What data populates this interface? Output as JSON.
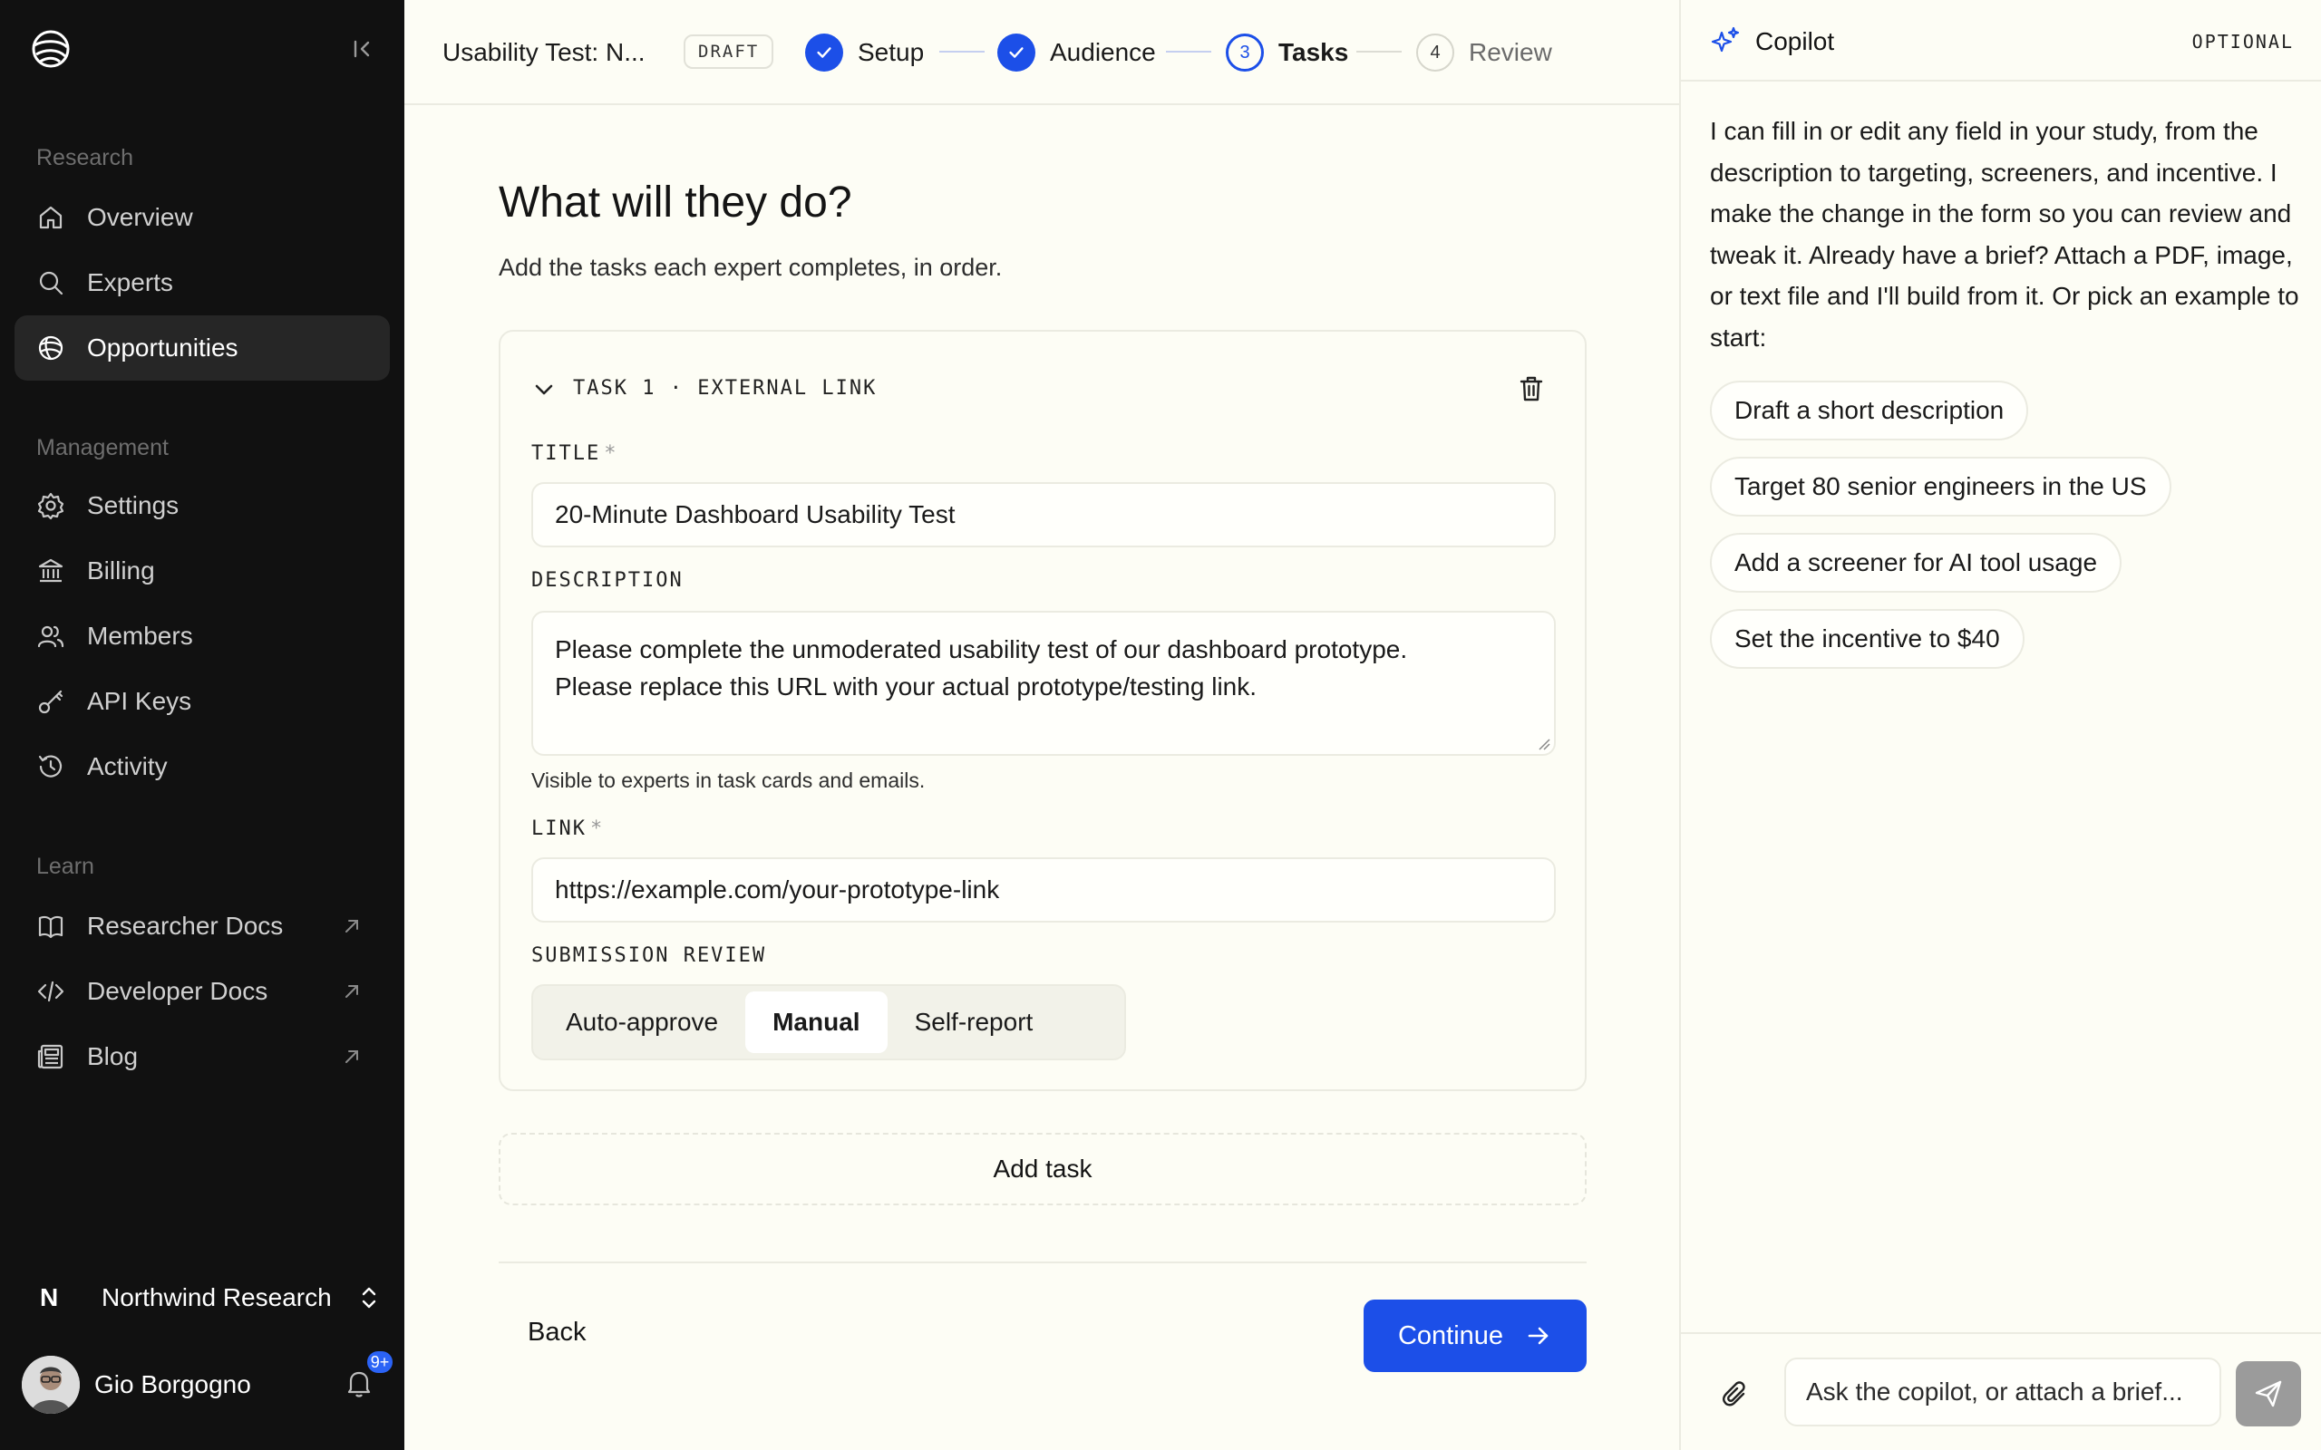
{
  "sidebar": {
    "sections": [
      {
        "label": "Research",
        "items": [
          {
            "label": "Overview",
            "icon": "home-icon"
          },
          {
            "label": "Experts",
            "icon": "search-icon"
          },
          {
            "label": "Opportunities",
            "icon": "globe-icon",
            "active": true
          }
        ]
      },
      {
        "label": "Management",
        "items": [
          {
            "label": "Settings",
            "icon": "gear-icon"
          },
          {
            "label": "Billing",
            "icon": "bank-icon"
          },
          {
            "label": "Members",
            "icon": "users-icon"
          },
          {
            "label": "API Keys",
            "icon": "key-icon"
          },
          {
            "label": "Activity",
            "icon": "history-icon"
          }
        ]
      },
      {
        "label": "Learn",
        "items": [
          {
            "label": "Researcher Docs",
            "icon": "book-icon",
            "external": true
          },
          {
            "label": "Developer Docs",
            "icon": "code-icon",
            "external": true
          },
          {
            "label": "Blog",
            "icon": "newspaper-icon",
            "external": true
          }
        ]
      }
    ],
    "org": {
      "initial": "N",
      "name": "Northwind Research"
    },
    "user": {
      "name": "Gio Borgogno",
      "notifications": "9+"
    }
  },
  "topbar": {
    "study_title": "Usability Test: N...",
    "status": "DRAFT",
    "steps": [
      {
        "number": "1",
        "label": "Setup",
        "state": "done"
      },
      {
        "number": "2",
        "label": "Audience",
        "state": "done"
      },
      {
        "number": "3",
        "label": "Tasks",
        "state": "current"
      },
      {
        "number": "4",
        "label": "Review",
        "state": "todo"
      }
    ]
  },
  "main": {
    "heading": "What will they do?",
    "subheading": "Add the tasks each expert completes, in order.",
    "task": {
      "label": "TASK 1 · EXTERNAL LINK",
      "title_label": "TITLE",
      "title_value": "20-Minute Dashboard Usability Test",
      "description_label": "DESCRIPTION",
      "description_lines": [
        "Please complete the unmoderated usability test of our dashboard prototype.",
        "Please replace this URL with your actual prototype/testing link."
      ],
      "description_help": "Visible to experts in task cards and emails.",
      "link_label": "LINK",
      "link_value": "https://example.com/your-prototype-link",
      "review_label": "SUBMISSION REVIEW",
      "review_options": [
        "Auto-approve",
        "Manual",
        "Self-report"
      ],
      "review_selected": "Manual",
      "required_marker": "*"
    },
    "add_task_label": "Add task",
    "back_label": "Back",
    "continue_label": "Continue"
  },
  "copilot": {
    "title": "Copilot",
    "tag": "OPTIONAL",
    "intro": "I can fill in or edit any field in your study, from the description to targeting, screeners, and incentive. I make the change in the form so you can review and tweak it. Already have a brief? Attach a PDF, image, or text file and I'll build from it. Or pick an example to start:",
    "suggestions": [
      "Draft a short description",
      "Target 80 senior engineers in the US",
      "Add a screener for AI tool usage",
      "Set the incentive to $40"
    ],
    "input_placeholder": "Ask the copilot, or attach a brief..."
  },
  "colors": {
    "accent": "#1c4fe8",
    "sidebar_bg": "#111111",
    "page_bg": "#fdfdf5",
    "badge": "#2b63f6"
  }
}
